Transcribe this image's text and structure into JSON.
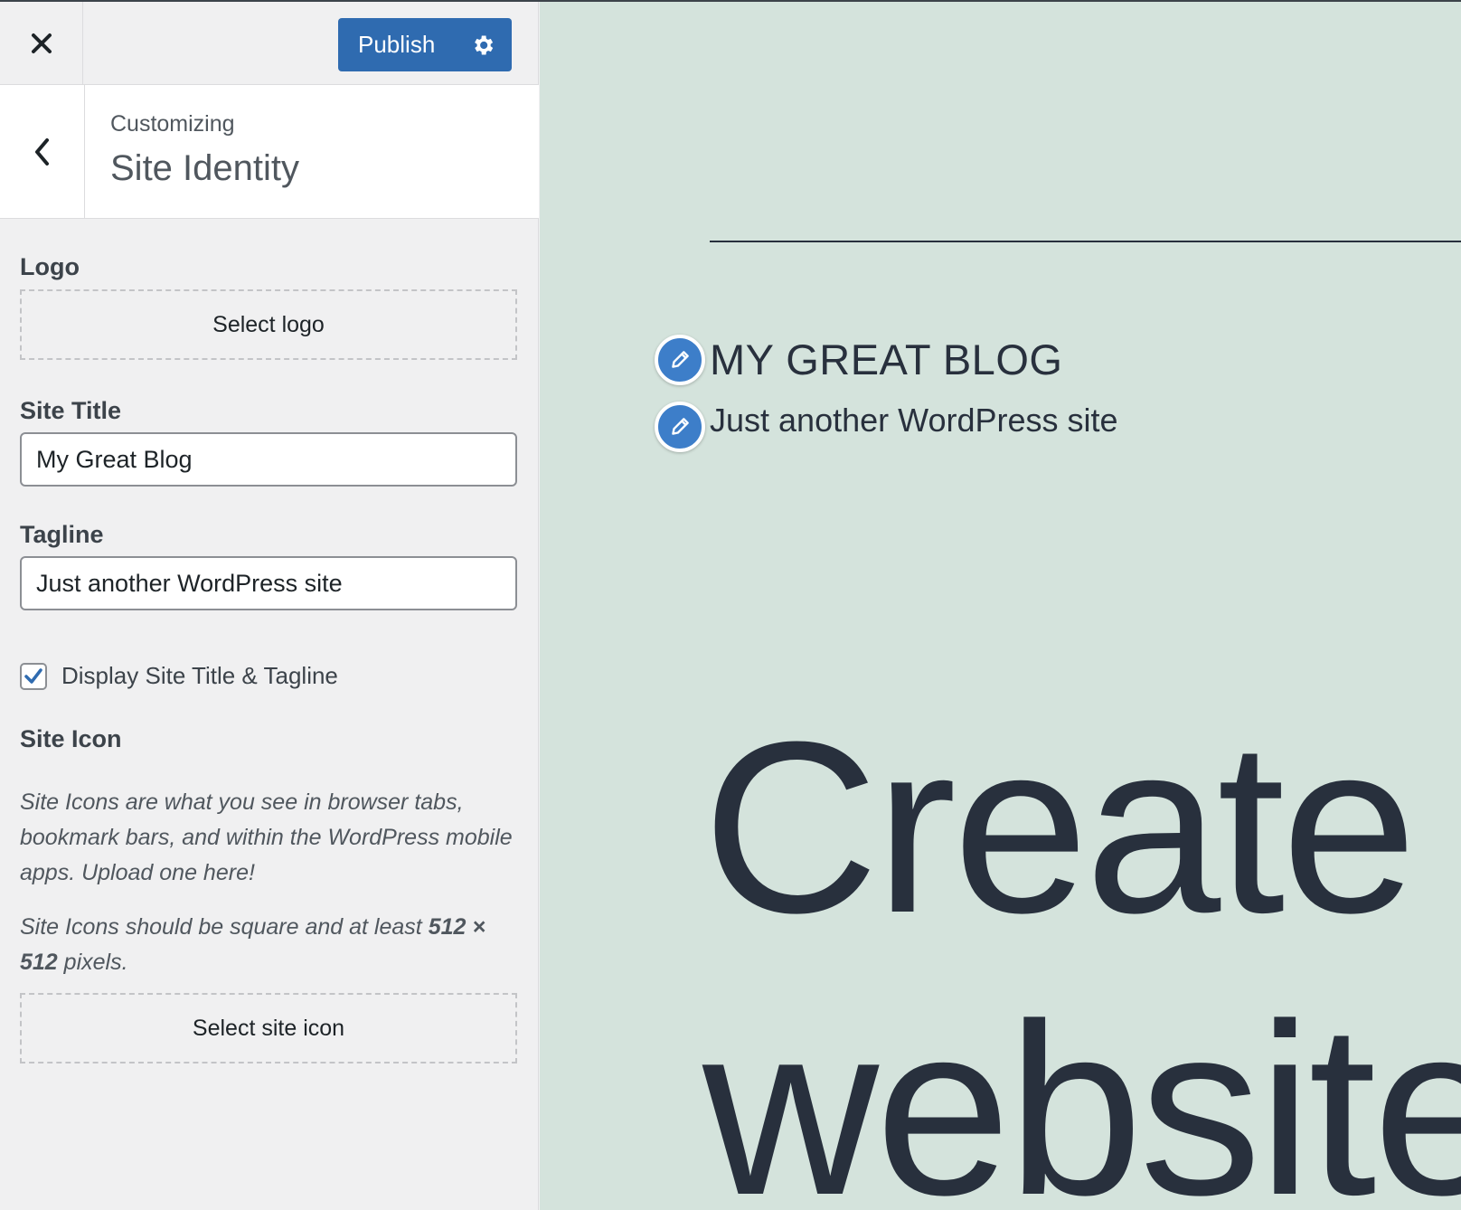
{
  "header": {
    "close_icon": "close-icon",
    "publish_label": "Publish",
    "settings_icon": "gear-icon",
    "accent_color": "#2f6bb0"
  },
  "section": {
    "back_icon": "chevron-left-icon",
    "context": "Customizing",
    "title": "Site Identity"
  },
  "logo": {
    "label": "Logo",
    "button": "Select logo"
  },
  "site_title": {
    "label": "Site Title",
    "value": "My Great Blog"
  },
  "tagline": {
    "label": "Tagline",
    "value": "Just another WordPress site"
  },
  "display_toggle": {
    "label": "Display Site Title & Tagline",
    "checked": true
  },
  "site_icon": {
    "label": "Site Icon",
    "description": "Site Icons are what you see in browser tabs, bookmark bars, and within the WordPress mobile apps. Upload one here!",
    "size_note_prefix": "Site Icons should be square and at least ",
    "size_note_value": "512 × 512",
    "size_note_suffix": " pixels.",
    "button": "Select site icon"
  },
  "preview": {
    "background": "#d4e3dc",
    "blog_title": "MY GREAT BLOG",
    "blog_tagline": "Just another WordPress site",
    "hero_line1": "Create",
    "hero_line2": "website",
    "edit_icon": "pencil-icon"
  }
}
